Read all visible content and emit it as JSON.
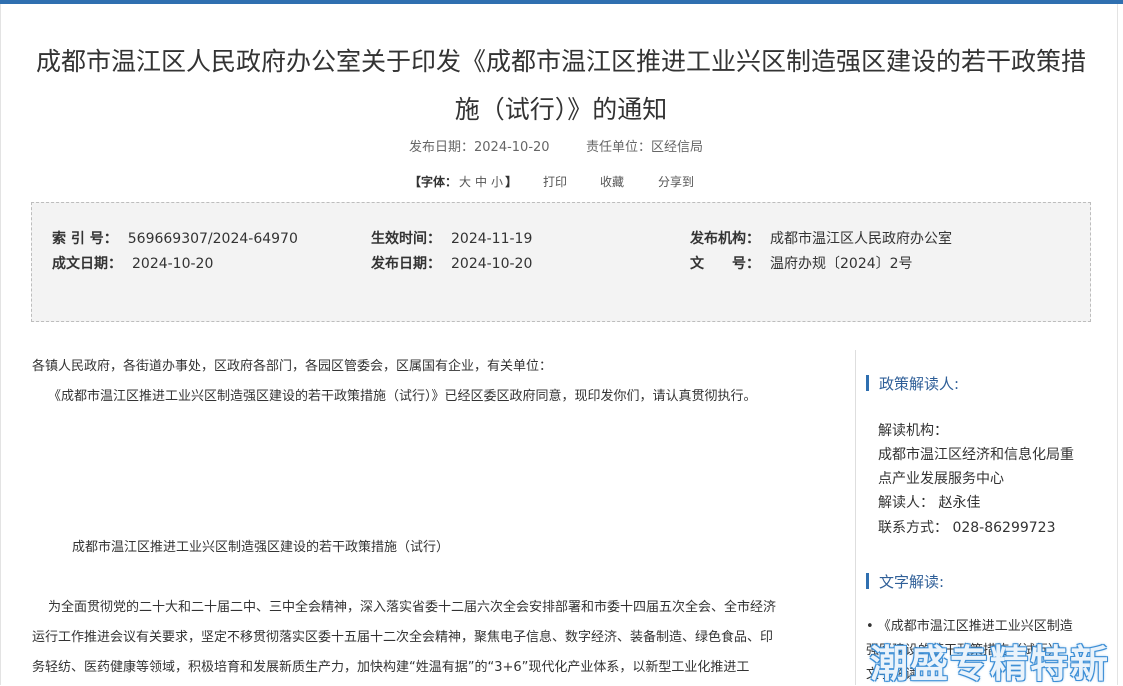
{
  "document": {
    "title_line1": "成都市温江区人民政府办公室关于印发《成都市温江区推进工业兴区制造强区建设的若干政策措",
    "title_line2": "施（试行）》的通知",
    "publish_date_label": "发布日期：2024-10-20",
    "responsible_unit_label": "责任单位：区经信局"
  },
  "toolbar": {
    "font_label": "【字体：",
    "font_large": "大",
    "font_medium": "中",
    "font_small": "小",
    "font_close": "】",
    "print": "打印",
    "favorite": "收藏",
    "share": "分享到"
  },
  "info": {
    "index_key": "索 引 号：",
    "index_val": "569669307/2024-64970",
    "effective_key": "生效时间：",
    "effective_val": "2024-11-19",
    "issuer_key": "发布机构：",
    "issuer_val": "成都市温江区人民政府办公室",
    "written_key": "成文日期：",
    "written_val": "2024-10-20",
    "publish_key": "发布日期：",
    "publish_val": "2024-10-20",
    "docno_key": "文　　号：",
    "docno_val": "温府办规〔2024〕2号"
  },
  "body": {
    "salutation": "各镇人民政府，各街道办事处，区政府各部门，各园区管委会，区属国有企业，有关单位：",
    "intro": "《成都市温江区推进工业兴区制造强区建设的若干政策措施（试行）》已经区委区政府同意，现印发你们，请认真贯彻执行。",
    "attachment_title": "成都市温江区推进工业兴区制造强区建设的若干政策措施（试行）",
    "p_line1": "为全面贯彻党的二十大和二十届二中、三中全会精神，深入落实省委十二届六次全会安排部署和市委十四届五次全会、全市经济",
    "p_line2": "运行工作推进会议有关要求，坚定不移贯彻落实区委十五届十二次全会精神，聚焦电子信息、数字经济、装备制造、绿色食品、印",
    "p_line3": "务轻纺、医药健康等领域，积极培育和发展新质生产力，加快构建“姓温有据”的“3+6”现代化产业体系，以新型工业化推进工"
  },
  "sidebar": {
    "interpreter_heading": "政策解读人:",
    "org_label": "解读机构：",
    "org_line1": "成都市温江区经济和信息化局重",
    "org_line2": "点产业发展服务中心",
    "person": "解读人：  赵永佳",
    "phone": "联系方式：  028-86299723",
    "text_heading": "文字解读:",
    "link_line1": "• 《成都市温江区推进工业兴区制造",
    "link_line2": "强区建设的若干政策措施（试行）》",
    "link_line3": "文字解读"
  },
  "watermark": "潮盛专精特新",
  "colors": {
    "accent": "#2f6fb0",
    "heading_blue": "#2f5f98",
    "infobox_bg": "#f3f3f3"
  }
}
